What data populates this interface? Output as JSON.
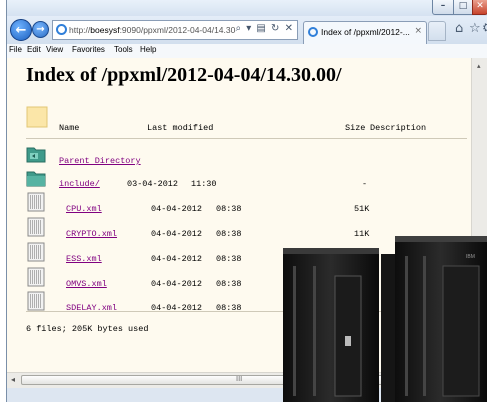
{
  "window": {
    "min_glyph": "–",
    "max_glyph": "□",
    "close_glyph": "✕"
  },
  "nav": {
    "back_glyph": "←",
    "forward_glyph": "→",
    "address_prefix": "http://",
    "address_host": "boesysf",
    "address_rest": ":9090/ppxml/2012-04-04/14.30",
    "address_controls": "⌕ ▾ ▤ ↻ ✕",
    "tab_label": "Index of /ppxml/2012-...",
    "tab_close": "×",
    "home_icon": "⌂",
    "star_icon": "☆",
    "gear_icon": "⚙"
  },
  "menu": [
    "File",
    "Edit",
    "View",
    "Favorites",
    "Tools",
    "Help"
  ],
  "page": {
    "heading": "Index of /ppxml/2012-04-04/14.30.00/",
    "columns": {
      "name": "Name",
      "modified": "Last modified",
      "size": "Size",
      "description": "Description"
    },
    "parent_label": "Parent Directory",
    "rows": [
      {
        "name": "include/",
        "date": "03-04-2012",
        "time": "11:30",
        "size": "-",
        "icon": "folder-icon"
      },
      {
        "name": "CPU.xml",
        "date": "04-04-2012",
        "time": "08:38",
        "size": "51K",
        "icon": "document-icon"
      },
      {
        "name": "CRYPTO.xml",
        "date": "04-04-2012",
        "time": "08:38",
        "size": "11K",
        "icon": "document-icon"
      },
      {
        "name": "ESS.xml",
        "date": "04-04-2012",
        "time": "08:38",
        "size": "",
        "icon": "document-icon"
      },
      {
        "name": "OMVS.xml",
        "date": "04-04-2012",
        "time": "08:38",
        "size": "",
        "icon": "document-icon"
      },
      {
        "name": "SDELAY.xml",
        "date": "04-04-2012",
        "time": "08:38",
        "size": "",
        "icon": "document-icon"
      }
    ],
    "footer": "6 files; 205K bytes used"
  },
  "scroll": {
    "left_arrow": "◂",
    "up_arrow": "▴",
    "grip": "III"
  },
  "overlay": {
    "brand": "IBM"
  }
}
